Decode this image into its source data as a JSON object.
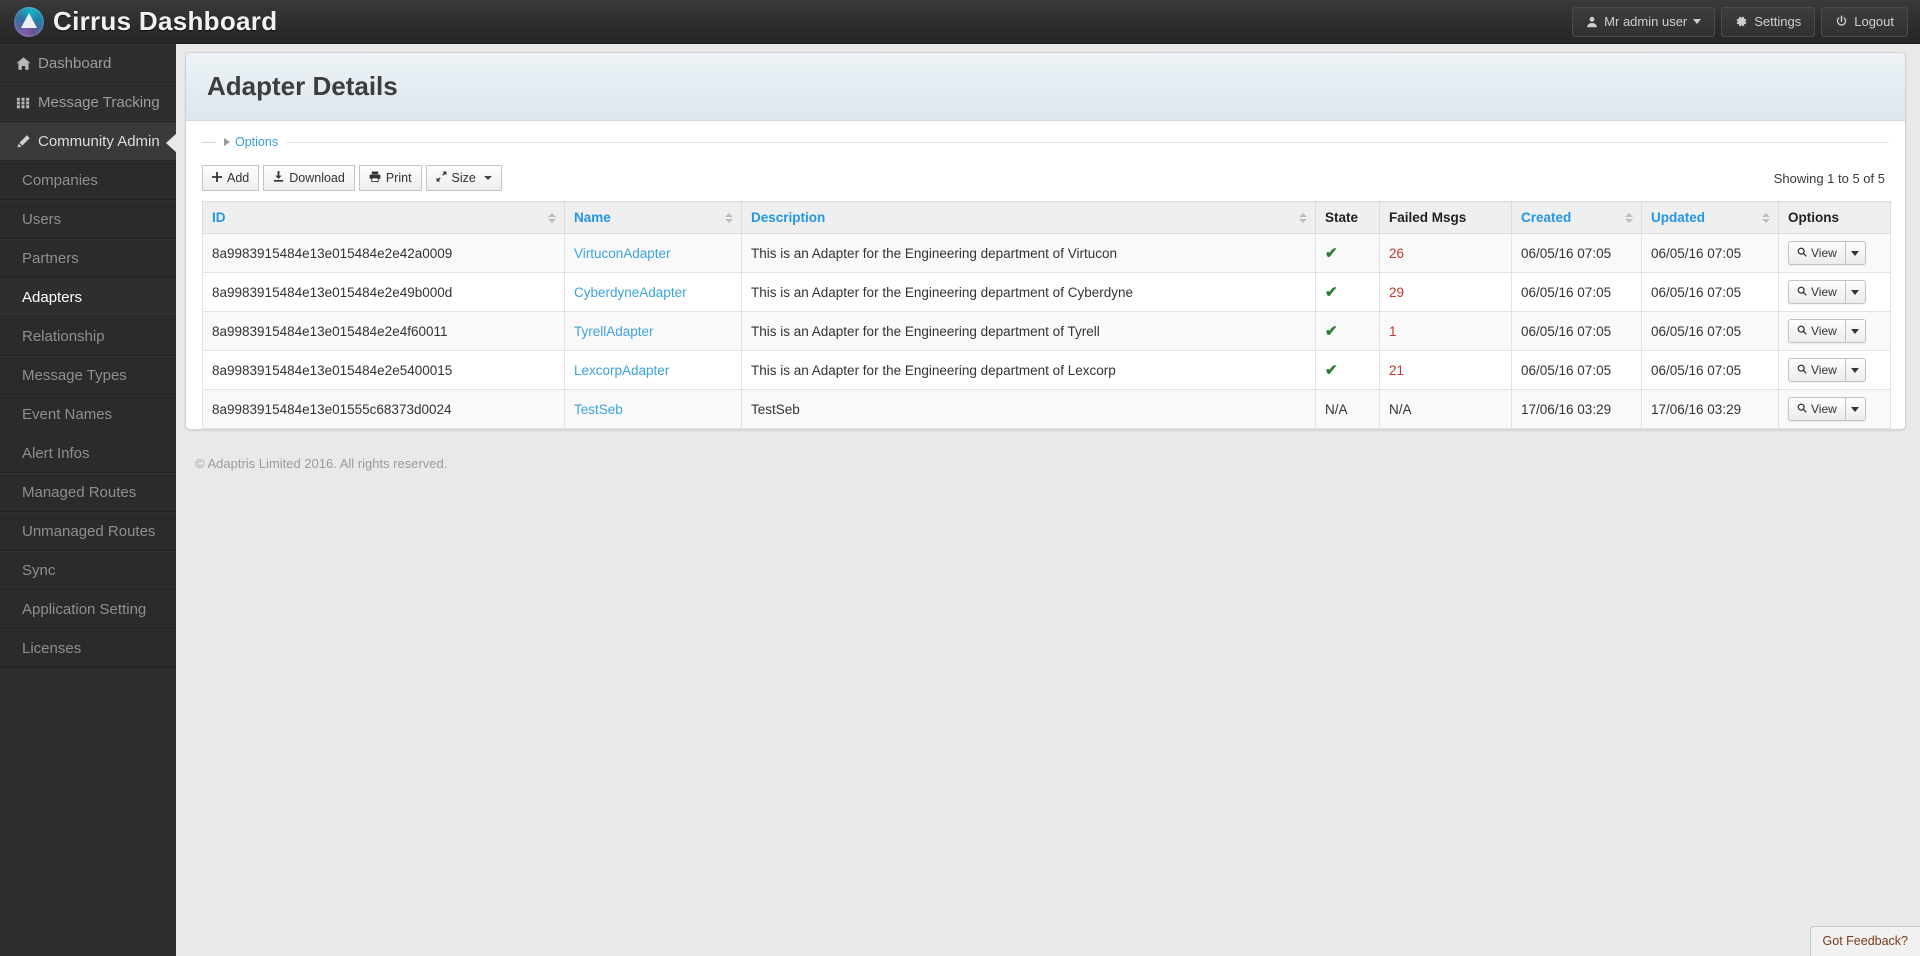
{
  "header": {
    "brand": "Cirrus Dashboard",
    "brand_logo_icon": "cirrus-logo-icon",
    "nav": [
      {
        "label": "Mr admin user",
        "icon": "user-icon",
        "has_caret": true
      },
      {
        "label": "Settings",
        "icon": "gear-icon",
        "has_caret": false
      },
      {
        "label": "Logout",
        "icon": "power-icon",
        "has_caret": false
      }
    ]
  },
  "sidebar": {
    "top_items": [
      {
        "label": "Dashboard",
        "icon": "home-icon",
        "active": false
      },
      {
        "label": "Message Tracking",
        "icon": "grid-icon",
        "active": false
      },
      {
        "label": "Community Admin",
        "icon": "pencil-icon",
        "active": true
      }
    ],
    "sub_items": [
      {
        "label": "Companies",
        "selected": false
      },
      {
        "label": "Users",
        "selected": false
      },
      {
        "label": "Partners",
        "selected": false
      },
      {
        "label": "Adapters",
        "selected": true
      },
      {
        "label": "Relationship",
        "selected": false
      },
      {
        "label": "Message Types",
        "selected": false
      },
      {
        "label": "Event Names",
        "selected": false
      },
      {
        "label": "Alert Infos",
        "selected": false
      },
      {
        "label": "Managed Routes",
        "selected": false
      },
      {
        "label": "Unmanaged Routes",
        "selected": false
      },
      {
        "label": "Sync",
        "selected": false
      },
      {
        "label": "Application Setting",
        "selected": false
      },
      {
        "label": "Licenses",
        "selected": false
      }
    ]
  },
  "page": {
    "title": "Adapter Details",
    "options_link": "Options",
    "showing": "Showing 1 to 5 of 5",
    "footer": "© Adaptris Limited 2016. All rights reserved."
  },
  "toolbar": {
    "add_label": "Add",
    "download_label": "Download",
    "print_label": "Print",
    "size_label": "Size"
  },
  "table": {
    "columns": [
      {
        "label": "ID",
        "sortable": true
      },
      {
        "label": "Name",
        "sortable": true
      },
      {
        "label": "Description",
        "sortable": true
      },
      {
        "label": "State",
        "sortable": false
      },
      {
        "label": "Failed Msgs",
        "sortable": false
      },
      {
        "label": "Created",
        "sortable": true
      },
      {
        "label": "Updated",
        "sortable": true
      },
      {
        "label": "Options",
        "sortable": false
      }
    ],
    "rows": [
      {
        "id": "8a9983915484e13e015484e2e42a0009",
        "name": "VirtuconAdapter",
        "description": "This is an Adapter for the Engineering department of Virtucon",
        "state": "ok",
        "state_text": "",
        "failed": "26",
        "created": "06/05/16 07:05",
        "updated": "06/05/16 07:05",
        "view_label": "View"
      },
      {
        "id": "8a9983915484e13e015484e2e49b000d",
        "name": "CyberdyneAdapter",
        "description": "This is an Adapter for the Engineering department of Cyberdyne",
        "state": "ok",
        "state_text": "",
        "failed": "29",
        "created": "06/05/16 07:05",
        "updated": "06/05/16 07:05",
        "view_label": "View"
      },
      {
        "id": "8a9983915484e13e015484e2e4f60011",
        "name": "TyrellAdapter",
        "description": "This is an Adapter for the Engineering department of Tyrell",
        "state": "ok",
        "state_text": "",
        "failed": "1",
        "created": "06/05/16 07:05",
        "updated": "06/05/16 07:05",
        "view_label": "View"
      },
      {
        "id": "8a9983915484e13e015484e2e5400015",
        "name": "LexcorpAdapter",
        "description": "This is an Adapter for the Engineering department of Lexcorp",
        "state": "ok",
        "state_text": "",
        "failed": "21",
        "created": "06/05/16 07:05",
        "updated": "06/05/16 07:05",
        "view_label": "View"
      },
      {
        "id": "8a9983915484e13e01555c68373d0024",
        "name": "TestSeb",
        "description": "TestSeb",
        "state": "na",
        "state_text": "N/A",
        "failed": "N/A",
        "created": "17/06/16 03:29",
        "updated": "17/06/16 03:29",
        "view_label": "View"
      }
    ]
  },
  "feedback": {
    "label": "Got Feedback?"
  },
  "colors": {
    "link_blue": "#3ca3e0",
    "header_blue": "#2196e8",
    "failed_red": "#c0392b",
    "state_green": "#2e7d32",
    "feedback_text": "#7a3b1e"
  }
}
